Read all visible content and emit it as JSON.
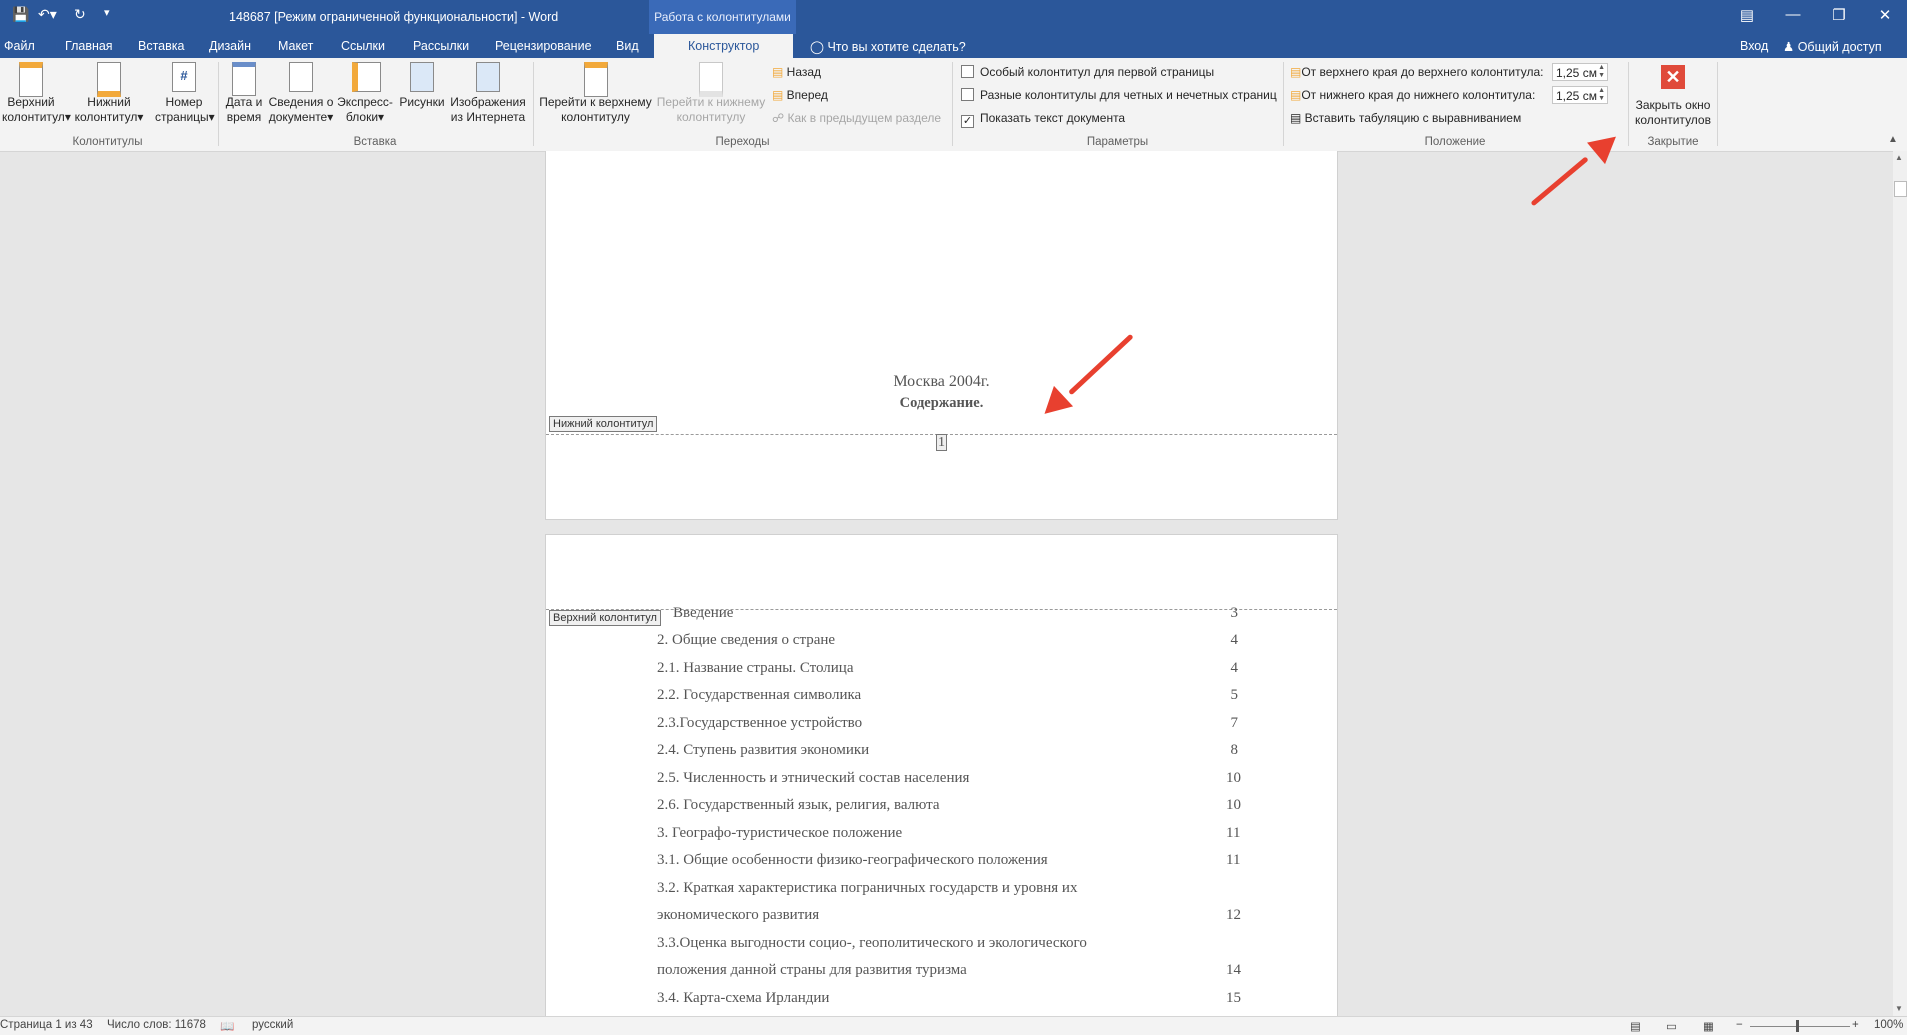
{
  "titlebar": {
    "title": "148687 [Режим ограниченной функциональности] - Word",
    "contextual_tab": "Работа с колонтитулами"
  },
  "tabs": {
    "file": "Файл",
    "home": "Главная",
    "insert": "Вставка",
    "design": "Дизайн",
    "layout": "Макет",
    "references": "Ссылки",
    "mailings": "Рассылки",
    "review": "Рецензирование",
    "view": "Вид",
    "constructor": "Конструктор",
    "tell_me": "Что вы хотите сделать?",
    "signin": "Вход",
    "share": "Общий доступ"
  },
  "ribbon": {
    "header_btn": [
      "Верхний",
      "колонтитул"
    ],
    "footer_btn": [
      "Нижний",
      "колонтитул"
    ],
    "pagenum_btn": [
      "Номер",
      "страницы"
    ],
    "group_hf": "Колонтитулы",
    "datetime_btn": [
      "Дата и",
      "время"
    ],
    "docinfo_btn": [
      "Сведения о",
      "документе"
    ],
    "quickparts_btn": [
      "Экспресс-",
      "блоки"
    ],
    "pictures_btn": "Рисунки",
    "online_btn": [
      "Изображения",
      "из Интернета"
    ],
    "group_insert": "Вставка",
    "goto_header_btn": [
      "Перейти к верхнему",
      "колонтитулу"
    ],
    "goto_footer_btn": [
      "Перейти к нижнему",
      "колонтитулу"
    ],
    "back": "Назад",
    "forward": "Вперед",
    "link_prev": "Как в предыдущем разделе",
    "group_nav": "Переходы",
    "opt_first": "Особый колонтитул для первой страницы",
    "opt_oddeven": "Разные колонтитулы для четных и нечетных страниц",
    "opt_showtext": "Показать текст документа",
    "opt_showtext_checked": true,
    "group_options": "Параметры",
    "pos_top_label": "От верхнего края до верхнего колонтитула:",
    "pos_top_value": "1,25 см",
    "pos_bottom_label": "От нижнего края до нижнего колонтитула:",
    "pos_bottom_value": "1,25 см",
    "insert_tab": "Вставить табуляцию с выравниванием",
    "group_position": "Положение",
    "close_btn": [
      "Закрыть окно",
      "колонтитулов"
    ],
    "group_close": "Закрытие"
  },
  "document": {
    "page1_line1": "Москва 2004г.",
    "page1_line2": "Содержание.",
    "footer_label": "Нижний колонтитул",
    "footer_page_number": "1",
    "header_label": "Верхний колонтитул",
    "toc": [
      {
        "title": "Введение",
        "page": "3"
      },
      {
        "title": "2. Общие сведения о стране",
        "page": "4"
      },
      {
        "title": "2.1. Название страны. Столица",
        "page": "4"
      },
      {
        "title": "2.2. Государственная символика",
        "page": "5"
      },
      {
        "title": "2.3.Государственное устройство",
        "page": "7"
      },
      {
        "title": "2.4. Ступень развития экономики",
        "page": "8"
      },
      {
        "title": "2.5. Численность и этнический состав населения",
        "page": "10"
      },
      {
        "title": "2.6. Государственный язык, религия, валюта",
        "page": "10"
      },
      {
        "title": "3. Географо-туристическое положение",
        "page": "11"
      },
      {
        "title": "3.1. Общие особенности физико-географического положения",
        "page": "11"
      },
      {
        "title": "3.2. Краткая характеристика пограничных государств и уровня их",
        "page": ""
      },
      {
        "title": "экономического развития",
        "page": "12"
      },
      {
        "title": "3.3.Оценка выгодности социо-, геополитического и экологического",
        "page": ""
      },
      {
        "title": "положения данной страны для развития туризма",
        "page": "14"
      },
      {
        "title": "3.4. Карта-схема Ирландии",
        "page": "15"
      }
    ]
  },
  "status": {
    "page": "Страница 1 из 43",
    "words": "Число слов: 11678",
    "language": "русский",
    "zoom": "100%"
  },
  "colors": {
    "accent": "#2b579a",
    "annotation_arrow": "#e8402f",
    "close_red": "#e04a3a"
  }
}
